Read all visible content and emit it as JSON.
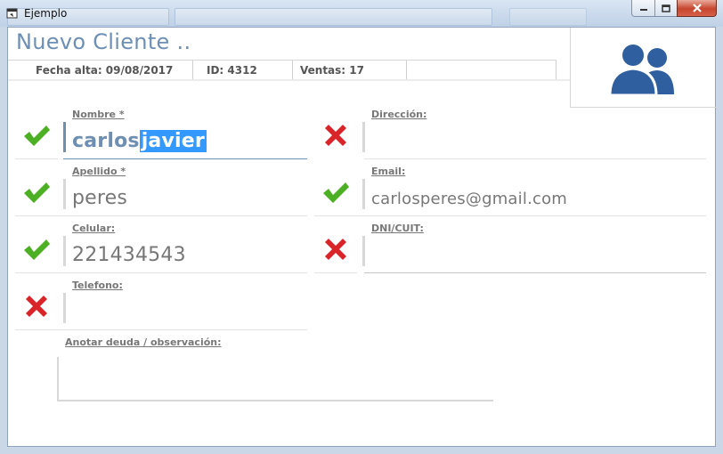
{
  "window": {
    "title": "Ejemplo"
  },
  "header": {
    "title": "Nuevo Cliente .."
  },
  "info": {
    "fecha": "Fecha alta:  09/08/2017",
    "id": "ID: 4312",
    "ventas": "Ventas:  17"
  },
  "fields": {
    "nombre": {
      "label": "Nombre *",
      "value_plain": "carlos",
      "value_selected": "javier",
      "valid": true
    },
    "apellido": {
      "label": "Apellido *",
      "value": "peres",
      "valid": true
    },
    "celular": {
      "label": "Celular:",
      "value": "221434543",
      "valid": true
    },
    "telefono": {
      "label": "Telefono:",
      "value": "",
      "valid": false
    },
    "direccion": {
      "label": "Dirección:",
      "value": "",
      "valid": false
    },
    "email": {
      "label": "Email:",
      "value": "carlosperes@gmail.com",
      "valid": true
    },
    "dni": {
      "label": "DNI/CUIT:",
      "value": "",
      "valid": false
    }
  },
  "notes": {
    "label": "Anotar deuda / observación:",
    "value": ""
  },
  "colors": {
    "accent": "#6f8fb2",
    "valid": "#4caf24",
    "invalid": "#d9252a",
    "avatar": "#2f5f9e"
  },
  "icons": {
    "valid": "checkmark-icon",
    "invalid": "cross-icon",
    "avatar": "users-icon"
  }
}
